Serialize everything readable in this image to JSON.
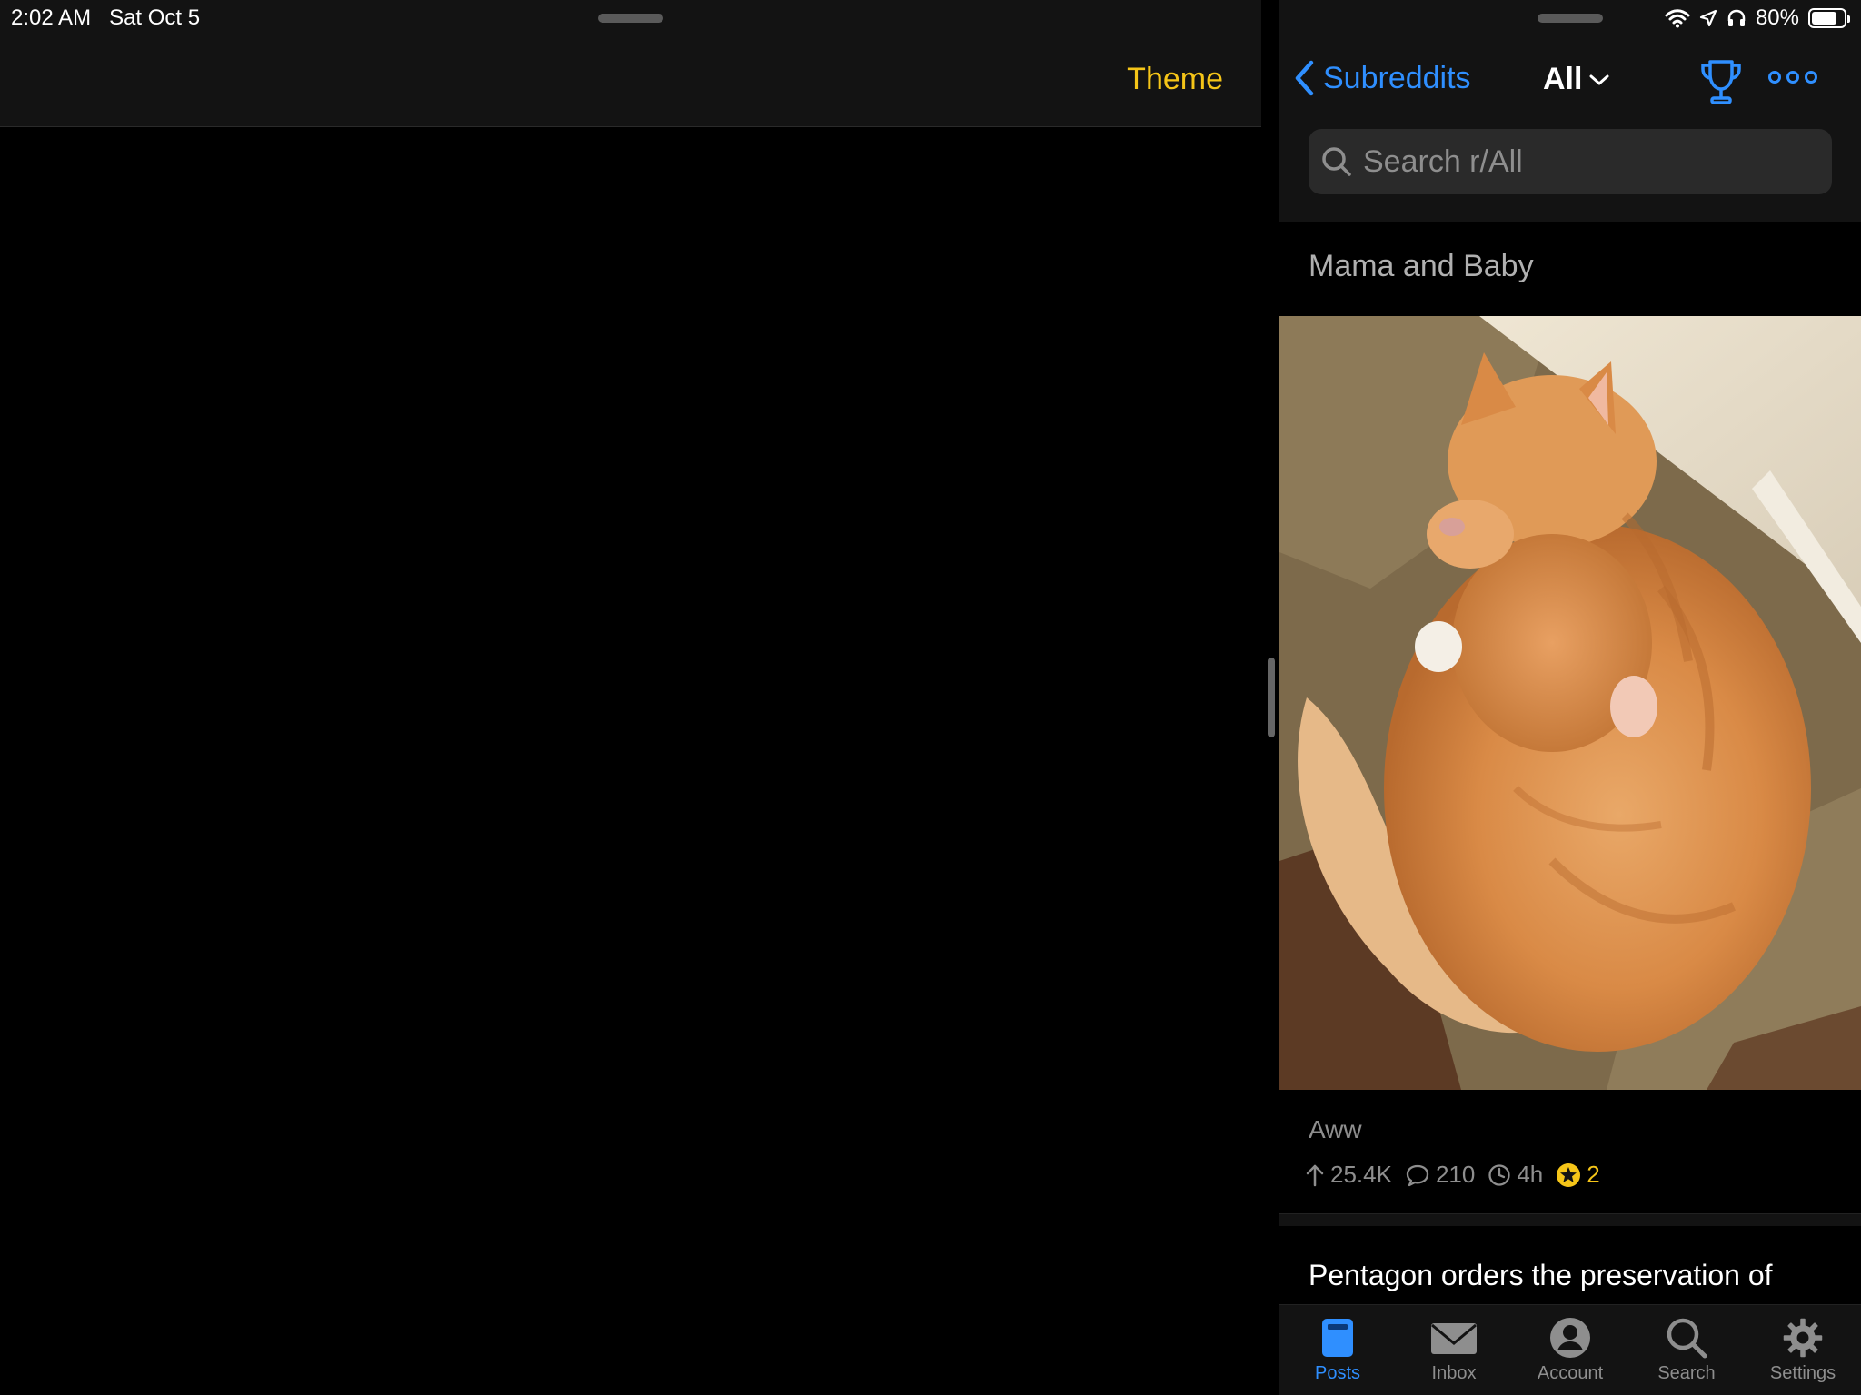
{
  "status_bar": {
    "time": "2:02 AM",
    "date": "Sat Oct 5",
    "battery_percent": "80%",
    "battery_level": 0.8
  },
  "left_pane": {
    "theme_label": "Theme"
  },
  "right_pane": {
    "nav": {
      "back_label": "Subreddits",
      "title": "All"
    },
    "search": {
      "placeholder": "Search r/All"
    },
    "post": {
      "title": "Mama and Baby",
      "subreddit": "Aww",
      "upvotes": "25.4K",
      "comments": "210",
      "age": "4h",
      "awards": "2"
    },
    "next_post": {
      "title": "Pentagon orders the preservation of"
    },
    "tabs": [
      {
        "label": "Posts",
        "icon": "posts-icon",
        "active": true
      },
      {
        "label": "Inbox",
        "icon": "envelope-icon",
        "active": false
      },
      {
        "label": "Account",
        "icon": "account-icon",
        "active": false
      },
      {
        "label": "Search",
        "icon": "magnifier-icon",
        "active": false
      },
      {
        "label": "Settings",
        "icon": "gear-icon",
        "active": false
      }
    ]
  },
  "colors": {
    "accent_blue": "#2f8fff",
    "theme_yellow": "#f5c518",
    "header_bg": "#131313",
    "muted_text": "#8e8e8e"
  }
}
